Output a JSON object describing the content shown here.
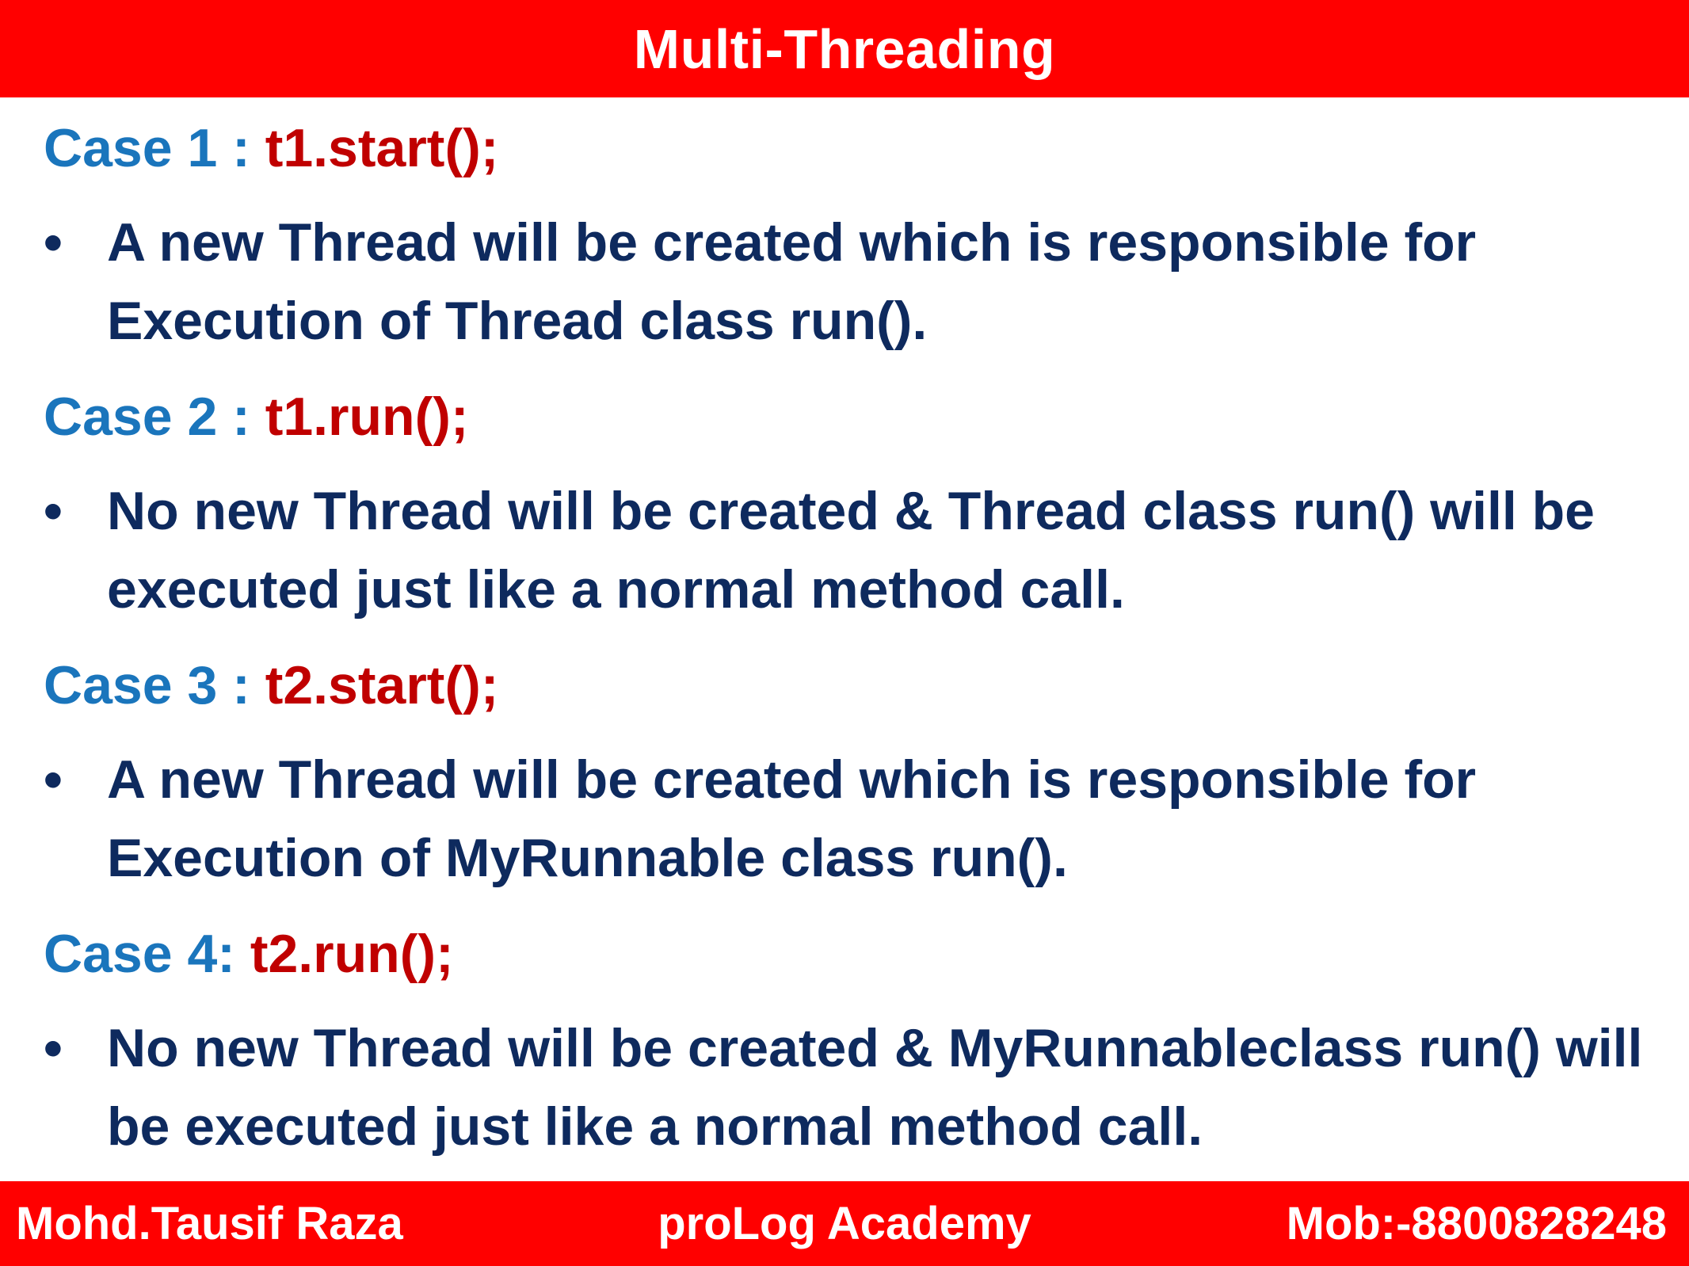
{
  "header": {
    "title": "Multi-Threading"
  },
  "cases": [
    {
      "label": "Case 1 : ",
      "code": "t1.start();",
      "bullet": "A new Thread will be created which is responsible for Execution of Thread class run()."
    },
    {
      "label": "Case 2 : ",
      "code": "t1.run();",
      "bullet": "No new Thread will be created & Thread class run() will be executed just like a normal method call."
    },
    {
      "label": "Case 3 : ",
      "code": "t2.start();",
      "bullet": "A new Thread will be created which is responsible for Execution of MyRunnable class run()."
    },
    {
      "label": "Case 4: ",
      "code": "t2.run();",
      "bullet": "No new Thread will be created & MyRunnableclass run() will be executed just like a normal method call."
    }
  ],
  "bullet_symbol": "•",
  "footer": {
    "author": "Mohd.Tausif Raza",
    "academy": "proLog Academy",
    "phone": "Mob:-8800828248"
  },
  "colors": {
    "bar": "#ff0000",
    "case_label": "#1a75bc",
    "case_code": "#c00000",
    "body_text": "#0e2a5e"
  }
}
